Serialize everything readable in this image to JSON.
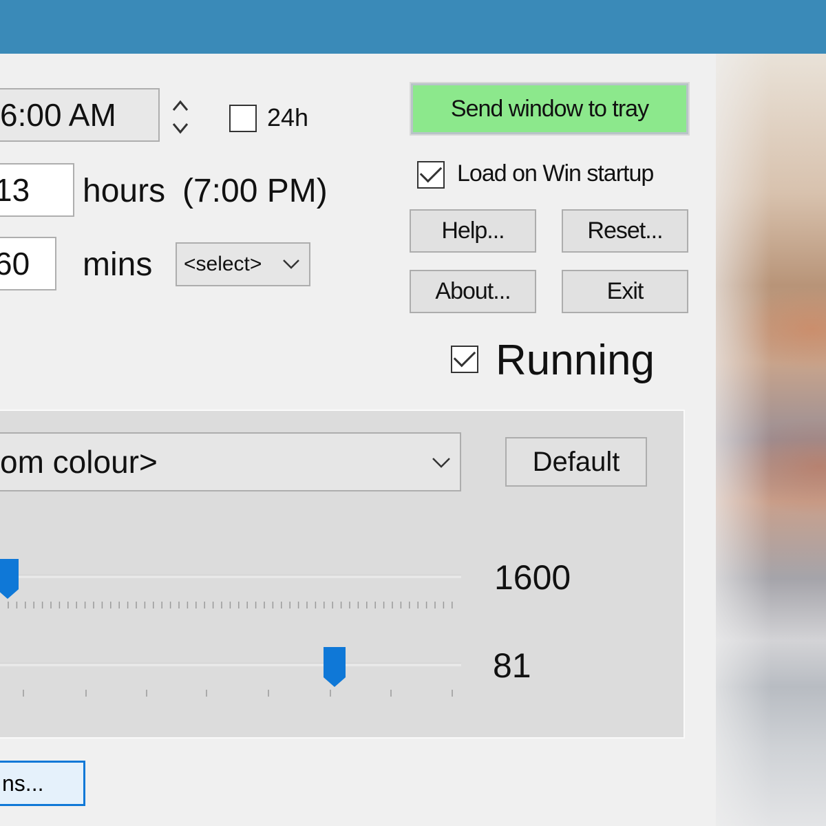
{
  "start_time": {
    "value": "6:00 AM"
  },
  "hours": {
    "value": "13",
    "label": "hours",
    "end_time": "(7:00 PM)"
  },
  "minutes": {
    "value": "60",
    "label": "mins",
    "select_value": "<select>"
  },
  "format24h": {
    "label": "24h",
    "checked": false
  },
  "buttons": {
    "send_to_tray": "Send window to tray",
    "help": "Help...",
    "reset": "Reset...",
    "about": "About...",
    "exit": "Exit",
    "default": "Default",
    "options": "ns..."
  },
  "load_on_startup": {
    "label": "Load on Win startup",
    "checked": true
  },
  "running": {
    "label": "Running",
    "checked": true
  },
  "colour_select": {
    "value": "om colour>"
  },
  "slider_temperature": {
    "value": "1600",
    "level_percent": 0
  },
  "slider_brightness": {
    "value": "81",
    "level_percent": 81
  },
  "colors": {
    "titlebar": "#3a8ab8",
    "tray_button": "#8ce88c",
    "slider_thumb": "#0f78d7",
    "focus_border": "#0f78d7"
  }
}
